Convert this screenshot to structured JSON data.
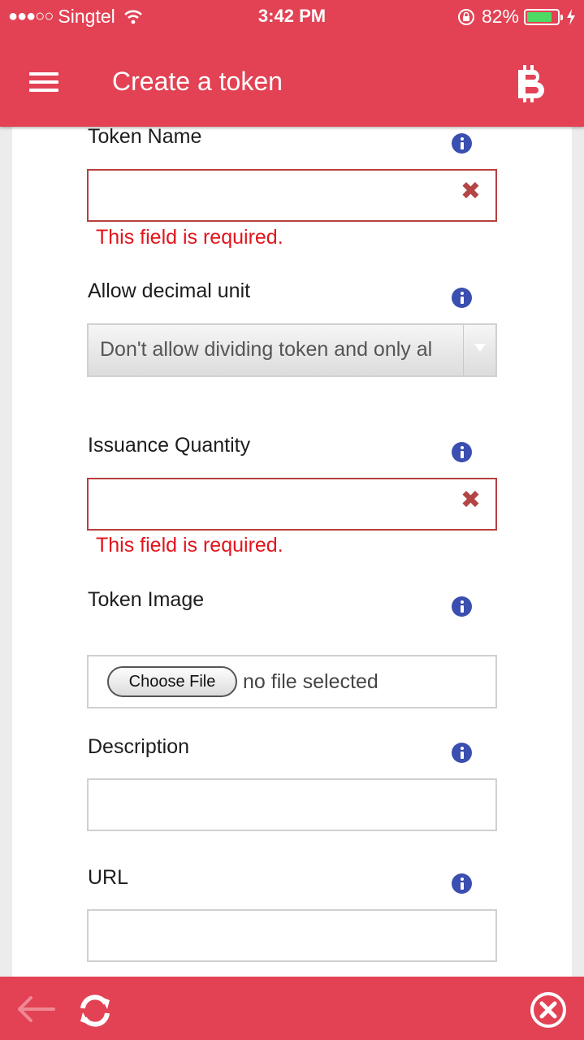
{
  "status_bar": {
    "carrier": "Singtel",
    "time": "3:42 PM",
    "battery_percent_label": "82%",
    "battery_level": 0.82,
    "signal_icon": "signal-dots-icon",
    "wifi_icon": "wifi-icon"
  },
  "header": {
    "title": "Create a token",
    "menu_icon": "hamburger-menu-icon",
    "right_icon": "bitcoin-icon",
    "background_color": "#e24254"
  },
  "form": {
    "token_name": {
      "label": "Token Name",
      "value": "",
      "error": "This field is required.",
      "clear_icon": "clear-x-icon"
    },
    "decimal_unit": {
      "label": "Allow decimal unit",
      "selected": "Don't allow dividing token and only al"
    },
    "issuance_quantity": {
      "label": "Issuance Quantity",
      "value": "",
      "error": "This field is required."
    },
    "token_image": {
      "label": "Token Image",
      "button_label": "Choose File",
      "status": "no file selected"
    },
    "description": {
      "label": "Description",
      "value": ""
    },
    "url": {
      "label": "URL",
      "value": ""
    },
    "info_icon": "info-icon"
  },
  "footer": {
    "back_icon": "back-arrow-icon",
    "refresh_icon": "refresh-icon",
    "close_icon": "close-circle-icon"
  },
  "colors": {
    "accent": "#e24254",
    "error_text": "#e2141c",
    "error_border": "#b84040",
    "info_icon": "#3a4fb0"
  }
}
